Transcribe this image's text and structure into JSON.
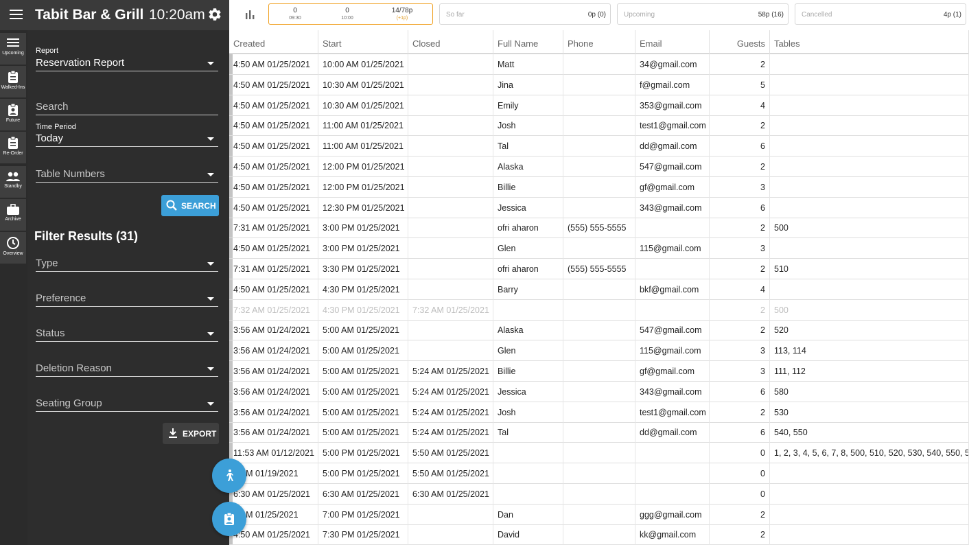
{
  "header": {
    "title": "Tabit Bar & Grill",
    "time": "10:20am",
    "menu_icon": "hamburger-icon",
    "settings_icon": "gear-icon"
  },
  "rail": [
    {
      "label": "Upcoming",
      "icon": "list-icon"
    },
    {
      "label": "Walked-Ins",
      "icon": "clipboard-icon"
    },
    {
      "label": "Future",
      "icon": "contact-card-icon"
    },
    {
      "label": "Re-Order",
      "icon": "clipboard-icon"
    },
    {
      "label": "Standby",
      "icon": "people-icon"
    },
    {
      "label": "Archive",
      "icon": "briefcase-icon"
    },
    {
      "label": "Overview",
      "icon": "clock-icon"
    }
  ],
  "panel": {
    "report_label": "Report",
    "report_value": "Reservation Report",
    "search_placeholder": "Search",
    "time_period_label": "Time Period",
    "time_period_value": "Today",
    "table_numbers_placeholder": "Table Numbers",
    "search_button": "SEARCH",
    "filter_title": "Filter Results (31)",
    "filters": [
      "Type",
      "Preference",
      "Status",
      "Deletion Reason",
      "Seating Group"
    ],
    "export_button": "EXPORT"
  },
  "stats": {
    "hours": [
      {
        "value": "0",
        "sub": "09:30"
      },
      {
        "value": "0",
        "sub": "10:00"
      },
      {
        "value": "14/78p",
        "sub": "(+1p)"
      }
    ],
    "so_far_label": "So far",
    "so_far_value": "0p (0)",
    "upcoming_label": "Upcoming",
    "upcoming_value": "58p (16)",
    "cancelled_label": "Cancelled",
    "cancelled_value": "4p (1)"
  },
  "table": {
    "columns": [
      "Created",
      "Start",
      "Closed",
      "Full Name",
      "Phone",
      "Email",
      "Guests",
      "Tables"
    ],
    "rows": [
      [
        "4:50 AM 01/25/2021",
        "10:00 AM 01/25/2021",
        "",
        "Matt",
        "",
        "34@gmail.com",
        "2",
        ""
      ],
      [
        "4:50 AM 01/25/2021",
        "10:30 AM 01/25/2021",
        "",
        "Jina",
        "",
        "f@gmail.com",
        "5",
        ""
      ],
      [
        "4:50 AM 01/25/2021",
        "10:30 AM 01/25/2021",
        "",
        "Emily",
        "",
        "353@gmail.com",
        "4",
        ""
      ],
      [
        "4:50 AM 01/25/2021",
        "11:00 AM 01/25/2021",
        "",
        "Josh",
        "",
        "test1@gmail.com",
        "2",
        ""
      ],
      [
        "4:50 AM 01/25/2021",
        "11:00 AM 01/25/2021",
        "",
        "Tal",
        "",
        "dd@gmail.com",
        "6",
        ""
      ],
      [
        "4:50 AM 01/25/2021",
        "12:00 PM 01/25/2021",
        "",
        "Alaska",
        "",
        "547@gmail.com",
        "2",
        ""
      ],
      [
        "4:50 AM 01/25/2021",
        "12:00 PM 01/25/2021",
        "",
        "Billie",
        "",
        "gf@gmail.com",
        "3",
        ""
      ],
      [
        "4:50 AM 01/25/2021",
        "12:30 PM 01/25/2021",
        "",
        "Jessica",
        "",
        "343@gmail.com",
        "6",
        ""
      ],
      [
        "7:31 AM 01/25/2021",
        "3:00 PM 01/25/2021",
        "",
        "ofri aharon",
        "(555) 555-5555",
        "",
        "2",
        "500"
      ],
      [
        "4:50 AM 01/25/2021",
        "3:00 PM 01/25/2021",
        "",
        "Glen",
        "",
        "115@gmail.com",
        "3",
        ""
      ],
      [
        "7:31 AM 01/25/2021",
        "3:30 PM 01/25/2021",
        "",
        "ofri aharon",
        "(555) 555-5555",
        "",
        "2",
        "510"
      ],
      [
        "4:50 AM 01/25/2021",
        "4:30 PM 01/25/2021",
        "",
        "Barry",
        "",
        "bkf@gmail.com",
        "4",
        ""
      ],
      [
        "7:32 AM 01/25/2021",
        "4:30 PM 01/25/2021",
        "7:32 AM 01/25/2021",
        "",
        "",
        "",
        "2",
        "500"
      ],
      [
        "3:56 AM 01/24/2021",
        "5:00 AM 01/25/2021",
        "",
        "Alaska",
        "",
        "547@gmail.com",
        "2",
        "520"
      ],
      [
        "3:56 AM 01/24/2021",
        "5:00 AM 01/25/2021",
        "",
        "Glen",
        "",
        "115@gmail.com",
        "3",
        "113, 114"
      ],
      [
        "3:56 AM 01/24/2021",
        "5:00 AM 01/25/2021",
        "5:24 AM 01/25/2021",
        "Billie",
        "",
        "gf@gmail.com",
        "3",
        "111, 112"
      ],
      [
        "3:56 AM 01/24/2021",
        "5:00 AM 01/25/2021",
        "5:24 AM 01/25/2021",
        "Jessica",
        "",
        "343@gmail.com",
        "6",
        "580"
      ],
      [
        "3:56 AM 01/24/2021",
        "5:00 AM 01/25/2021",
        "5:24 AM 01/25/2021",
        "Josh",
        "",
        "test1@gmail.com",
        "2",
        "530"
      ],
      [
        "3:56 AM 01/24/2021",
        "5:00 AM 01/25/2021",
        "5:24 AM 01/25/2021",
        "Tal",
        "",
        "dd@gmail.com",
        "6",
        "540, 550"
      ],
      [
        "11:53 AM 01/12/2021",
        "5:00 PM 01/25/2021",
        "5:50 AM 01/25/2021",
        "",
        "",
        "",
        "0",
        "1, 2, 3, 4, 5, 6, 7, 8, 500, 510, 520, 530, 540, 550, 560, 5"
      ],
      [
        "9 AM 01/19/2021",
        "5:00 PM 01/25/2021",
        "5:50 AM 01/25/2021",
        "",
        "",
        "",
        "0",
        ""
      ],
      [
        "6:30 AM 01/25/2021",
        "6:30 AM 01/25/2021",
        "6:30 AM 01/25/2021",
        "",
        "",
        "",
        "0",
        ""
      ],
      [
        "0 AM 01/25/2021",
        "7:00 PM 01/25/2021",
        "",
        "Dan",
        "",
        "ggg@gmail.com",
        "2",
        ""
      ],
      [
        "4:50 AM 01/25/2021",
        "7:30 PM 01/25/2021",
        "",
        "David",
        "",
        "kk@gmail.com",
        "2",
        ""
      ]
    ],
    "faded_row": 12
  },
  "fabs": [
    {
      "icon": "walk-in-icon"
    },
    {
      "icon": "contact-card-icon"
    }
  ],
  "colors": {
    "accent": "#3c9fd8",
    "hour_border": "#f0a020",
    "sidebar_bg": "#2d2d2d"
  }
}
